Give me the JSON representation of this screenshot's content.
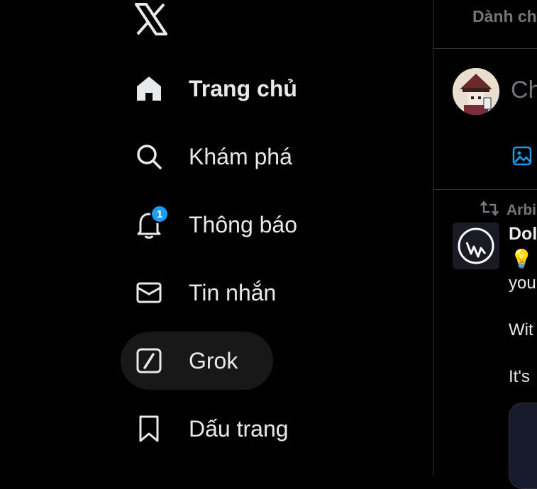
{
  "nav": {
    "items": [
      {
        "label": "Trang chủ",
        "icon": "home-icon"
      },
      {
        "label": "Khám phá",
        "icon": "search-icon"
      },
      {
        "label": "Thông báo",
        "icon": "bell-icon",
        "badge": "1"
      },
      {
        "label": "Tin nhắn",
        "icon": "mail-icon"
      },
      {
        "label": "Grok",
        "icon": "grok-icon"
      },
      {
        "label": "Dấu trang",
        "icon": "bookmark-icon"
      }
    ]
  },
  "feed": {
    "tab_label": "Dành ch",
    "compose_placeholder": "Ch",
    "retweet_label": "Arbi",
    "post": {
      "author": "Dol",
      "lines": [
        "you",
        "Wit",
        "It's "
      ]
    }
  },
  "colors": {
    "accent": "#1d9bf0",
    "background": "#000000",
    "text": "#e7e9ea",
    "muted": "#71767b"
  }
}
